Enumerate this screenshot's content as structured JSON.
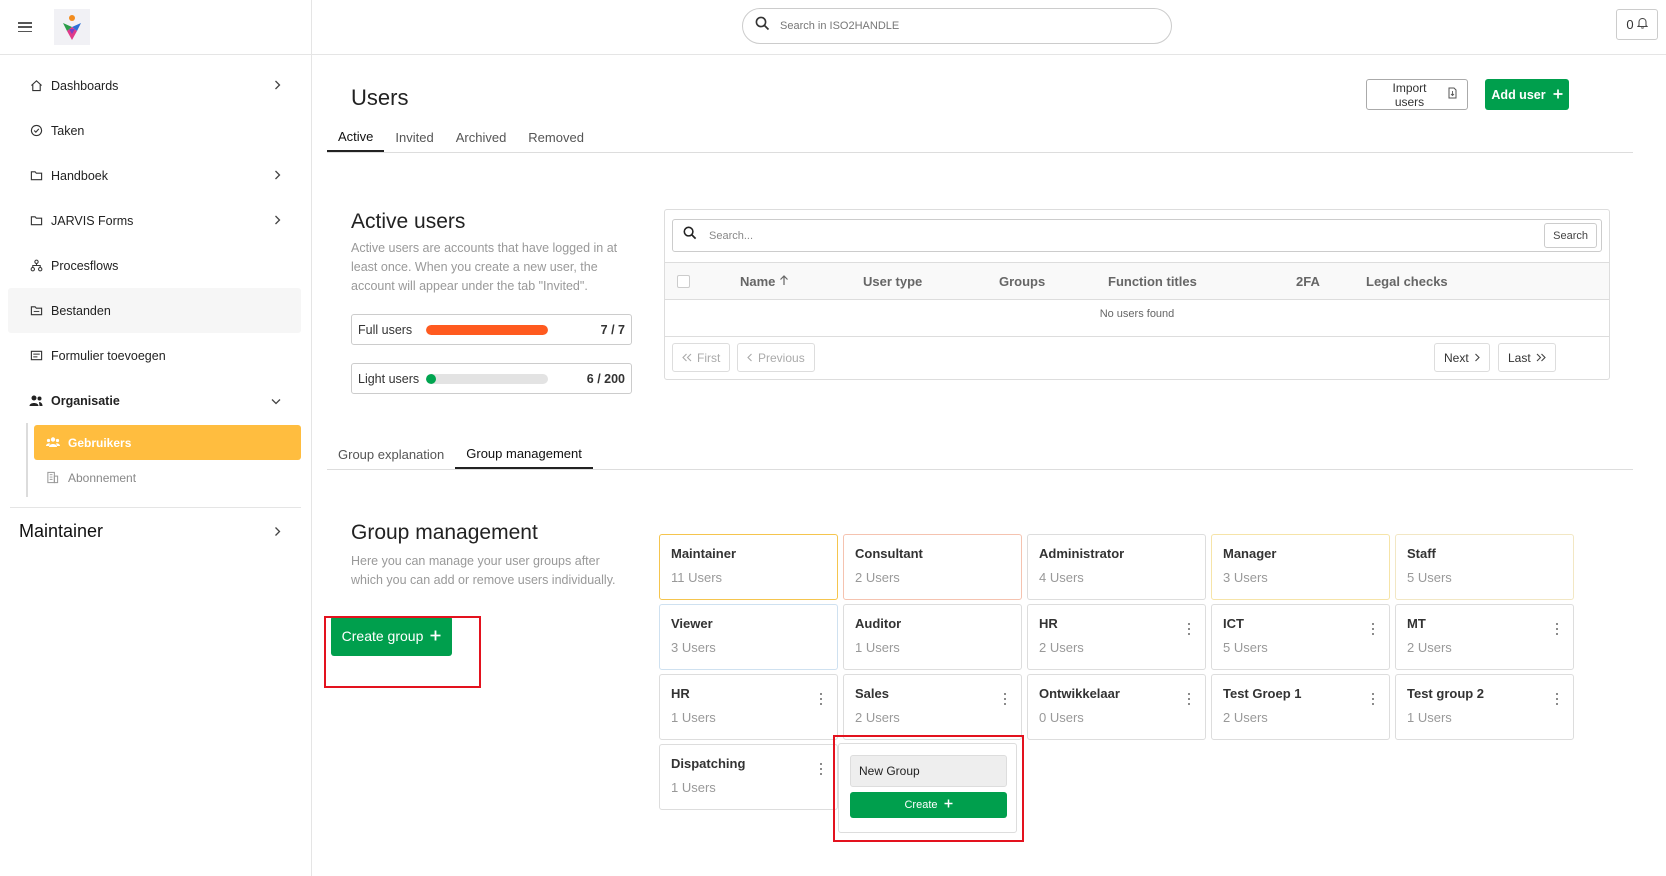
{
  "app": {
    "search_placeholder": "Search in ISO2HANDLE",
    "notifications_count": "0"
  },
  "sidebar": {
    "items": [
      {
        "label": "Dashboards",
        "icon": "home-icon",
        "has_chevron": true
      },
      {
        "label": "Taken",
        "icon": "check-circle-icon",
        "has_chevron": false
      },
      {
        "label": "Handboek",
        "icon": "folder-icon",
        "has_chevron": true
      },
      {
        "label": "JARVIS Forms",
        "icon": "folder-icon",
        "has_chevron": true
      },
      {
        "label": "Procesflows",
        "icon": "flow-icon",
        "has_chevron": false
      },
      {
        "label": "Bestanden",
        "icon": "files-icon",
        "has_chevron": false
      },
      {
        "label": "Formulier toevoegen",
        "icon": "form-icon",
        "has_chevron": false
      },
      {
        "label": "Organisatie",
        "icon": "users-icon",
        "has_chevron": true
      }
    ],
    "subitems": [
      {
        "label": "Gebruikers",
        "icon": "users-icon",
        "active": true
      },
      {
        "label": "Abonnement",
        "icon": "building-icon",
        "active": false
      }
    ],
    "maintainer": "Maintainer"
  },
  "header": {
    "title": "Users",
    "import_label": "Import users",
    "add_label": "Add user"
  },
  "user_tabs": [
    "Active",
    "Invited",
    "Archived",
    "Removed"
  ],
  "active_users": {
    "title": "Active users",
    "description": "Active users are accounts that have logged in at least once. When you create a new user, the account will appear under the tab \"Invited\".",
    "full": {
      "label": "Full users",
      "value": "7 / 7",
      "used": 7,
      "total": 7,
      "color": "#ff5a1f"
    },
    "light": {
      "label": "Light users",
      "value": "6 / 200",
      "used": 6,
      "total": 200,
      "color": "#00a550"
    }
  },
  "table": {
    "search_placeholder": "Search...",
    "search_button": "Search",
    "columns": [
      "Name",
      "User type",
      "Groups",
      "Function titles",
      "2FA",
      "Legal checks"
    ],
    "empty": "No users found",
    "pager": {
      "first": "First",
      "previous": "Previous",
      "next": "Next",
      "last": "Last"
    }
  },
  "group_tabs": [
    "Group explanation",
    "Group management"
  ],
  "group_management": {
    "title": "Group management",
    "description": "Here you can manage your user groups after which you can add or remove users individually.",
    "create_label": "Create group",
    "new_group_value": "New Group",
    "new_group_create_label": "Create",
    "groups": [
      {
        "name": "Maintainer",
        "count": "11 Users",
        "border": "#f5c54e",
        "menu": false
      },
      {
        "name": "Consultant",
        "count": "2 Users",
        "border": "#f5c3b0",
        "menu": false
      },
      {
        "name": "Administrator",
        "count": "4 Users",
        "border": "#dddddd",
        "menu": false
      },
      {
        "name": "Manager",
        "count": "3 Users",
        "border": "#f6e4a8",
        "menu": false
      },
      {
        "name": "Staff",
        "count": "5 Users",
        "border": "#f2e7c4",
        "menu": false
      },
      {
        "name": "Viewer",
        "count": "3 Users",
        "border": "#cfe1f0",
        "menu": false
      },
      {
        "name": "Auditor",
        "count": "1 Users",
        "border": "#dddddd",
        "menu": false
      },
      {
        "name": "HR",
        "count": "2 Users",
        "border": "#dddddd",
        "menu": true
      },
      {
        "name": "ICT",
        "count": "5 Users",
        "border": "#dddddd",
        "menu": true
      },
      {
        "name": "MT",
        "count": "2 Users",
        "border": "#dddddd",
        "menu": true
      },
      {
        "name": "HR",
        "count": "1 Users",
        "border": "#dddddd",
        "menu": true
      },
      {
        "name": "Sales",
        "count": "2 Users",
        "border": "#dddddd",
        "menu": true
      },
      {
        "name": "Ontwikkelaar",
        "count": "0 Users",
        "border": "#dddddd",
        "menu": true
      },
      {
        "name": "Test Groep 1",
        "count": "2 Users",
        "border": "#dddddd",
        "menu": true
      },
      {
        "name": "Test group 2",
        "count": "1 Users",
        "border": "#dddddd",
        "menu": true
      },
      {
        "name": "Dispatching",
        "count": "1 Users",
        "border": "#dddddd",
        "menu": true
      }
    ]
  },
  "colors": {
    "accent_green": "#009f4d",
    "active_nav": "#ffbd3f",
    "highlight_red": "#e3121e"
  }
}
